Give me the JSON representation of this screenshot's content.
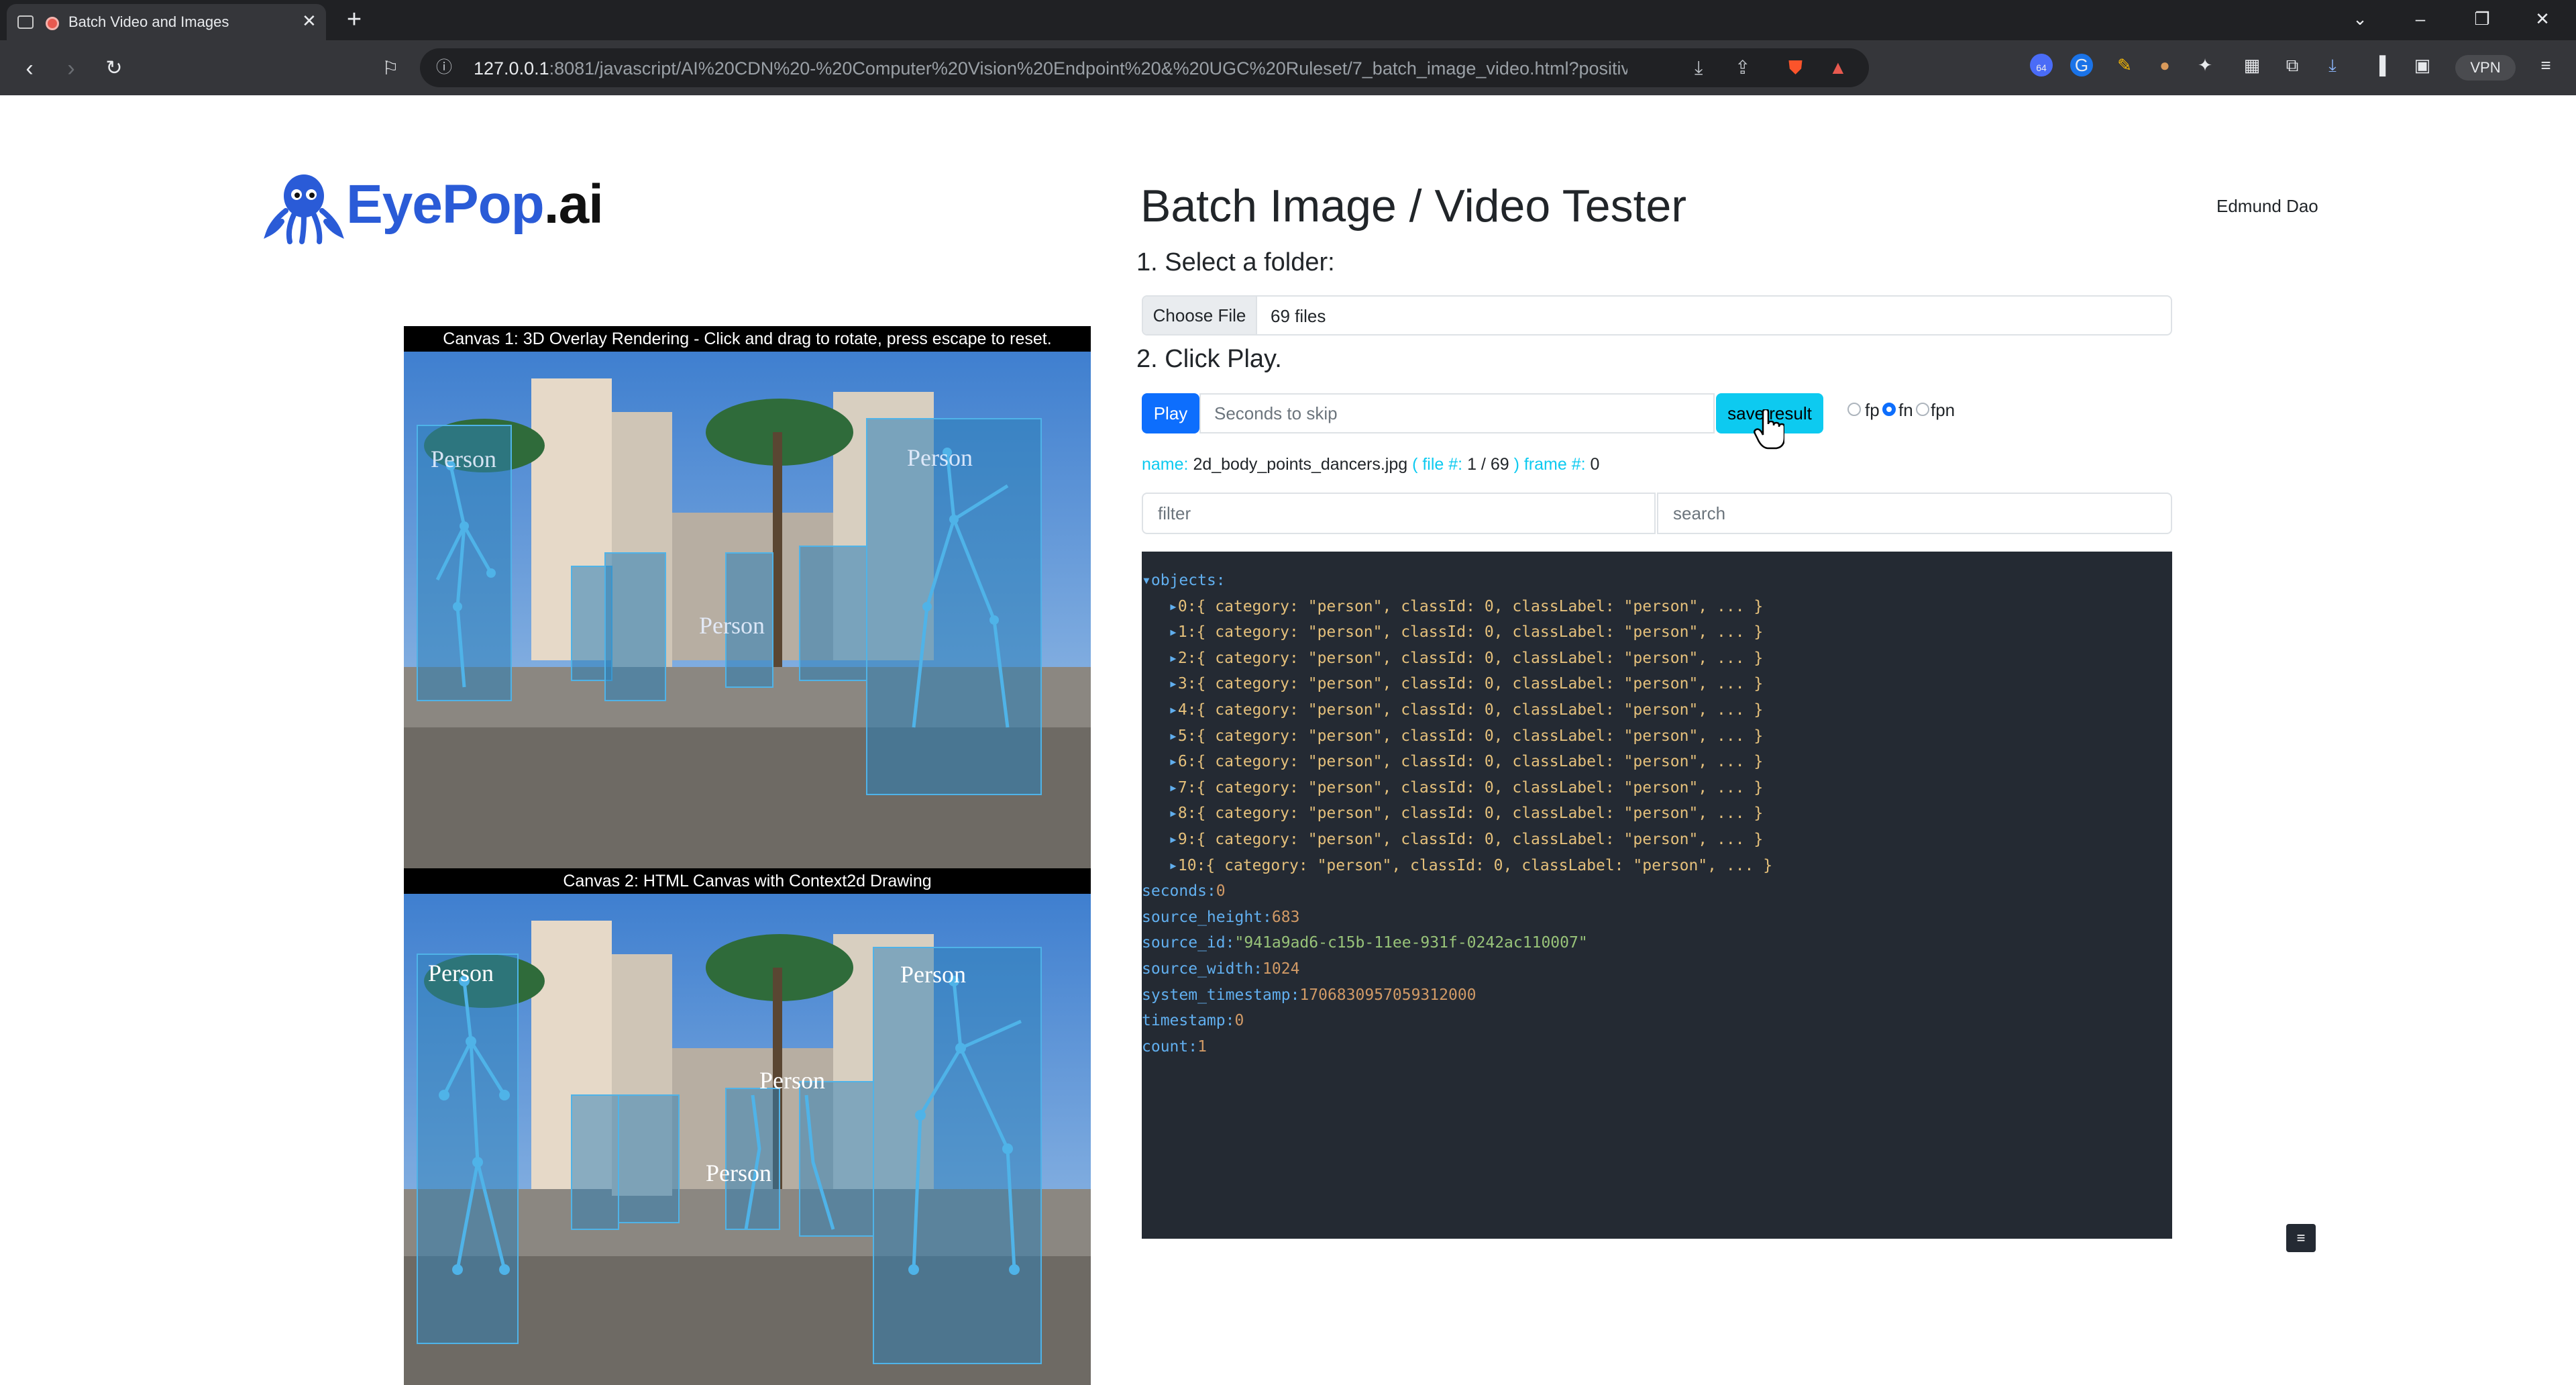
{
  "browser": {
    "tab_title": "Batch Video and Images",
    "url_host": "127.0.0.1",
    "url_rest": ":8081/javascript/AI%20CDN%20-%20Computer%20Vision%20Endpoint%20&%20UGC%20Ruleset/7_batch_image_video.html?positiveN...",
    "vpn_label": "VPN",
    "ext_badge": "64"
  },
  "logo": {
    "main": "EyePop",
    "suffix": ".ai"
  },
  "header": {
    "title": "Batch Image / Video Tester",
    "user": "Edmund Dao"
  },
  "step1": {
    "heading": "1. Select a folder:",
    "choose_label": "Choose File",
    "file_count": "69 files"
  },
  "step2": {
    "heading": "2. Click Play.",
    "play_label": "Play",
    "skip_placeholder": "Seconds to skip",
    "save_label": "save result",
    "radios": [
      {
        "label": "fp",
        "checked": false
      },
      {
        "label": "fn",
        "checked": true
      },
      {
        "label": "fpn",
        "checked": false
      }
    ]
  },
  "status": {
    "name_key": "name:",
    "name_value": "2d_body_points_dancers.jpg",
    "file_key": "( file #:",
    "file_value": "1 / 69",
    "frame_key": ") frame #:",
    "frame_value": "0"
  },
  "filters": {
    "filter_placeholder": "filter",
    "search_placeholder": "search"
  },
  "json_view": {
    "root_key": "objects",
    "items": [
      "0:{ category: \"person\", classId: 0, classLabel: \"person\", ... }",
      "1:{ category: \"person\", classId: 0, classLabel: \"person\", ... }",
      "2:{ category: \"person\", classId: 0, classLabel: \"person\", ... }",
      "3:{ category: \"person\", classId: 0, classLabel: \"person\", ... }",
      "4:{ category: \"person\", classId: 0, classLabel: \"person\", ... }",
      "5:{ category: \"person\", classId: 0, classLabel: \"person\", ... }",
      "6:{ category: \"person\", classId: 0, classLabel: \"person\", ... }",
      "7:{ category: \"person\", classId: 0, classLabel: \"person\", ... }",
      "8:{ category: \"person\", classId: 0, classLabel: \"person\", ... }",
      "9:{ category: \"person\", classId: 0, classLabel: \"person\", ... }",
      "10:{ category: \"person\", classId: 0, classLabel: \"person\", ... }"
    ],
    "fields": [
      {
        "key": "seconds",
        "value": "0",
        "type": "num"
      },
      {
        "key": "source_height",
        "value": "683",
        "type": "num"
      },
      {
        "key": "source_id",
        "value": "\"941a9ad6-c15b-11ee-931f-0242ac110007\"",
        "type": "str"
      },
      {
        "key": "source_width",
        "value": "1024",
        "type": "num"
      },
      {
        "key": "system_timestamp",
        "value": "1706830957059312000",
        "type": "num"
      },
      {
        "key": "timestamp",
        "value": "0",
        "type": "num"
      },
      {
        "key": "count",
        "value": "1",
        "type": "num"
      }
    ]
  },
  "canvas1": {
    "caption": "Canvas 1: 3D Overlay Rendering - Click and drag to rotate, press escape to reset."
  },
  "canvas2": {
    "caption": "Canvas 2: HTML Canvas with Context2d Drawing"
  },
  "detection_label": "Person",
  "colors": {
    "primary": "#0d6efd",
    "info": "#0dcaf0",
    "panel": "#242a33",
    "brand": "#2a5bd7"
  }
}
